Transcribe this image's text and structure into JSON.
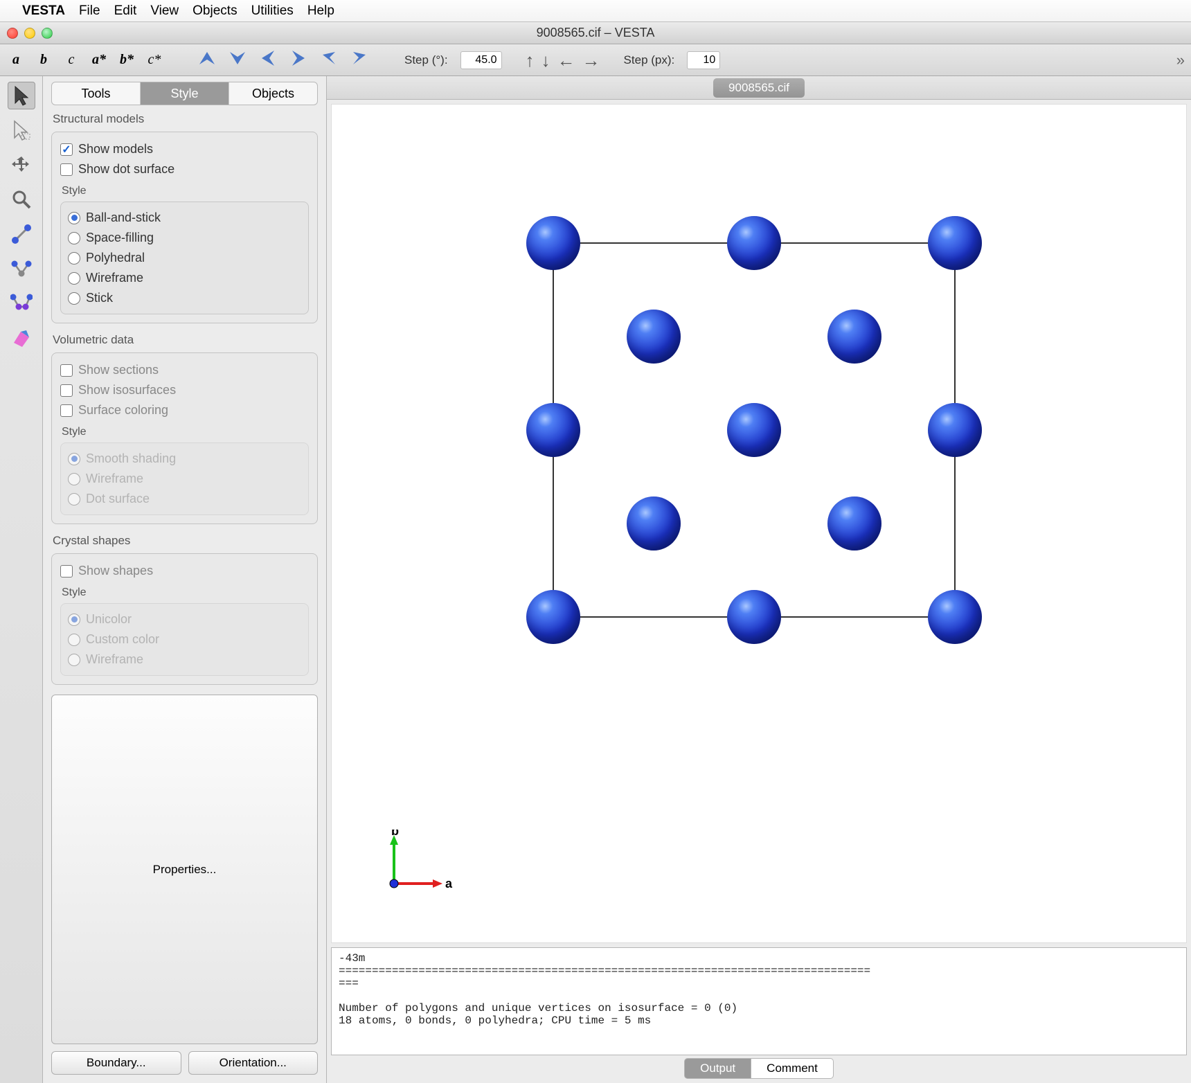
{
  "menubar": {
    "app": "VESTA",
    "items": [
      "File",
      "Edit",
      "View",
      "Objects",
      "Utilities",
      "Help"
    ]
  },
  "window": {
    "title": "9008565.cif – VESTA"
  },
  "toolbar": {
    "axes": [
      "a",
      "b",
      "c",
      "a*",
      "b*",
      "c*"
    ],
    "step_deg_label": "Step (°):",
    "step_deg_value": "45.0",
    "step_px_label": "Step (px):",
    "step_px_value": "10"
  },
  "sidebar": {
    "tabs": [
      "Tools",
      "Style",
      "Objects"
    ],
    "active_tab": "Style",
    "structural": {
      "title": "Structural models",
      "show_models": "Show models",
      "show_dot_surface": "Show dot surface",
      "style_label": "Style",
      "styles": [
        "Ball-and-stick",
        "Space-filling",
        "Polyhedral",
        "Wireframe",
        "Stick"
      ],
      "selected_style": "Ball-and-stick"
    },
    "volumetric": {
      "title": "Volumetric data",
      "show_sections": "Show sections",
      "show_isosurfaces": "Show isosurfaces",
      "surface_coloring": "Surface coloring",
      "style_label": "Style",
      "styles": [
        "Smooth shading",
        "Wireframe",
        "Dot surface"
      ],
      "selected_style": "Smooth shading"
    },
    "crystal": {
      "title": "Crystal shapes",
      "show_shapes": "Show shapes",
      "style_label": "Style",
      "styles": [
        "Unicolor",
        "Custom color",
        "Wireframe"
      ],
      "selected_style": "Unicolor"
    },
    "properties_btn": "Properties...",
    "boundary_btn": "Boundary...",
    "orientation_btn": "Orientation..."
  },
  "document": {
    "tab_label": "9008565.cif"
  },
  "axes_gizmo": {
    "a": "a",
    "b": "b"
  },
  "output": {
    "lines": "-43m\n================================================================================\n===\n\nNumber of polygons and unique vertices on isosurface = 0 (0)\n18 atoms, 0 bonds, 0 polyhedra; CPU time = 5 ms",
    "tabs": [
      "Output",
      "Comment"
    ],
    "active_tab": "Output"
  }
}
